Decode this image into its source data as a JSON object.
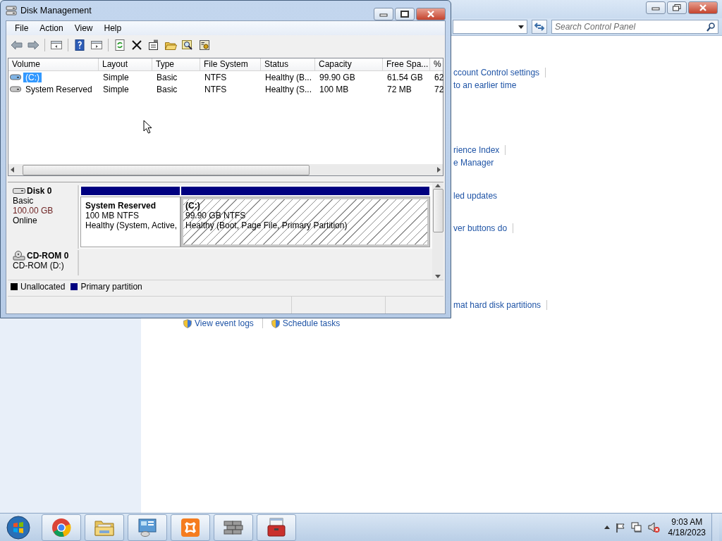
{
  "control_panel": {
    "search": {
      "placeholder": "Search Control Panel"
    },
    "link_groups": [
      [
        {
          "text": "ccount Control settings",
          "separator": true
        },
        {
          "text": "to an earlier time",
          "separator": false
        }
      ],
      [
        {
          "text": "rience Index",
          "separator": true
        },
        {
          "text": "e Manager",
          "separator": false
        }
      ],
      [
        {
          "text": "led updates",
          "separator": false
        }
      ],
      [
        {
          "text": "ver buttons do",
          "separator": true
        }
      ],
      [
        {
          "text": "mat hard disk partitions",
          "separator": true
        }
      ]
    ],
    "bottom_links": [
      {
        "text": "View event logs",
        "separator": true
      },
      {
        "text": "Schedule tasks",
        "separator": false
      }
    ]
  },
  "disk_management": {
    "title": "Disk Management",
    "menu": [
      "File",
      "Action",
      "View",
      "Help"
    ],
    "volume_list": {
      "columns": [
        "Volume",
        "Layout",
        "Type",
        "File System",
        "Status",
        "Capacity",
        "Free Spa...",
        "%"
      ],
      "rows": [
        {
          "selected": true,
          "cells": [
            "(C:)",
            "Simple",
            "Basic",
            "NTFS",
            "Healthy (B...",
            "99.90 GB",
            "61.54 GB",
            "62"
          ]
        },
        {
          "selected": false,
          "cells": [
            "System Reserved",
            "Simple",
            "Basic",
            "NTFS",
            "Healthy (S...",
            "100 MB",
            "72 MB",
            "72"
          ]
        }
      ]
    },
    "disks": [
      {
        "kind": "disk",
        "name": "Disk 0",
        "type": "Basic",
        "size": "100.00 GB",
        "state": "Online",
        "partitions": [
          {
            "name": "System Reserved",
            "size": "100 MB NTFS",
            "status": "Healthy (System, Active,",
            "selected": false
          },
          {
            "name": "(C:)",
            "size": "99.90 GB NTFS",
            "status": "Healthy (Boot, Page File, Primary Partition)",
            "selected": true
          }
        ]
      },
      {
        "kind": "cdrom",
        "name": "CD-ROM 0",
        "type": "CD-ROM (D:)"
      }
    ],
    "legend": [
      {
        "label": "Unallocated",
        "color": "#000000"
      },
      {
        "label": "Primary partition",
        "color": "#000080"
      }
    ]
  },
  "taskbar": {
    "time": "9:03 AM",
    "date": "4/18/2023"
  }
}
